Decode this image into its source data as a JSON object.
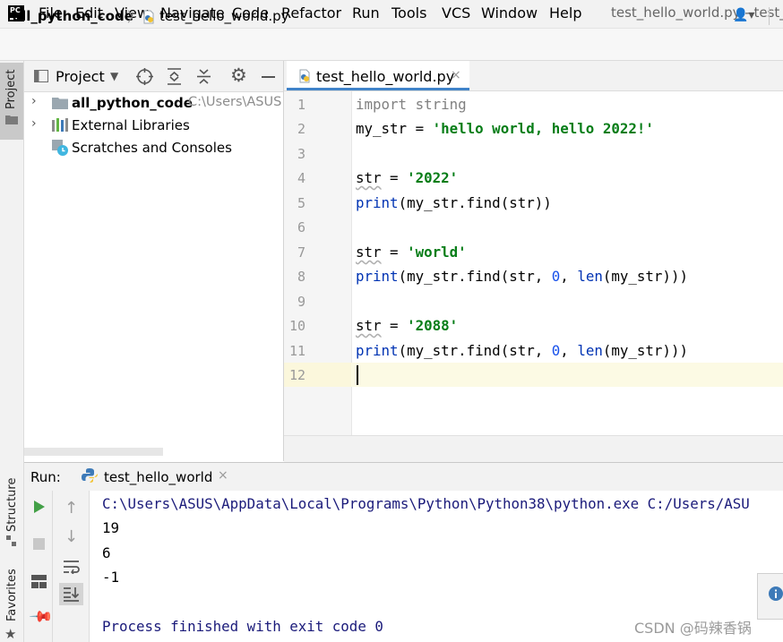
{
  "menubar": {
    "logo_text": "PC",
    "items": [
      "File",
      "Edit",
      "View",
      "Navigate",
      "Code",
      "Refactor",
      "Run",
      "Tools",
      "VCS",
      "Window",
      "Help"
    ],
    "window_title": "test_hello_world.py - test_"
  },
  "navbar": {
    "project": "all_python_code",
    "file": "test_hello_world.py"
  },
  "left_stripe": {
    "project": "Project",
    "structure": "Structure",
    "favorites": "Favorites"
  },
  "project_panel": {
    "title": "Project",
    "tree": [
      {
        "label": "all_python_code",
        "path": "C:\\Users\\ASUS"
      },
      {
        "label": "External Libraries"
      },
      {
        "label": "Scratches and Consoles"
      }
    ]
  },
  "editor": {
    "tab_label": "test_hello_world.py",
    "line_numbers": [
      "1",
      "2",
      "3",
      "4",
      "5",
      "6",
      "7",
      "8",
      "9",
      "10",
      "11",
      "12"
    ],
    "code": {
      "l1_kw": "import",
      "l1_rest": " string",
      "l2_var": "my_str = ",
      "l2_str": "'hello world, hello 2022!'",
      "l4_var": "str",
      "l4_eq": " = ",
      "l4_str": "'2022'",
      "l5_fn": "print",
      "l5_rest": "(my_str.find(str))",
      "l7_var": "str",
      "l7_eq": " = ",
      "l7_str": "'world'",
      "l8_fn": "print",
      "l8_a": "(my_str.find(str, ",
      "l8_num": "0",
      "l8_b": ", ",
      "l8_len": "len",
      "l8_c": "(my_str)))",
      "l10_var": "str",
      "l10_eq": " = ",
      "l10_str": "'2088'",
      "l11_fn": "print",
      "l11_a": "(my_str.find(str, ",
      "l11_num": "0",
      "l11_b": ", ",
      "l11_len": "len",
      "l11_c": "(my_str)))"
    }
  },
  "run_panel": {
    "label": "Run:",
    "tab_label": "test_hello_world",
    "close": "×",
    "output": [
      "C:\\Users\\ASUS\\AppData\\Local\\Programs\\Python\\Python38\\python.exe C:/Users/ASU",
      "19",
      "6",
      "-1",
      "",
      "Process finished with exit code 0"
    ]
  },
  "watermark": "CSDN @码辣香锅",
  "colors": {
    "keyword": "#0033b3",
    "string": "#067d17",
    "number": "#1750eb",
    "console_text": "#1a1a7a",
    "run_green": "#43a047",
    "accent_tab": "#4083c9"
  }
}
